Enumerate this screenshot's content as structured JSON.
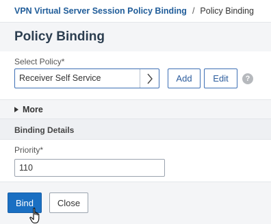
{
  "breadcrumb": {
    "parent": "VPN Virtual Server Session Policy Binding",
    "separator": "/",
    "current": "Policy Binding"
  },
  "panel": {
    "title": "Policy Binding"
  },
  "select_policy": {
    "label": "Select Policy*",
    "value": "Receiver Self Service",
    "chevron": "›"
  },
  "buttons": {
    "add": "Add",
    "edit": "Edit",
    "bind": "Bind",
    "close": "Close"
  },
  "help": {
    "icon": "help-icon",
    "glyph": "?"
  },
  "more": {
    "label": "More",
    "expanded": false
  },
  "binding_details": {
    "title": "Binding Details"
  },
  "priority": {
    "label": "Priority*",
    "value": "110"
  },
  "colors": {
    "primary": "#1a6fc2",
    "link": "#1f5c99",
    "border_accent": "#3c6eb4"
  },
  "cursor": {
    "icon": "hand-pointer-icon"
  }
}
